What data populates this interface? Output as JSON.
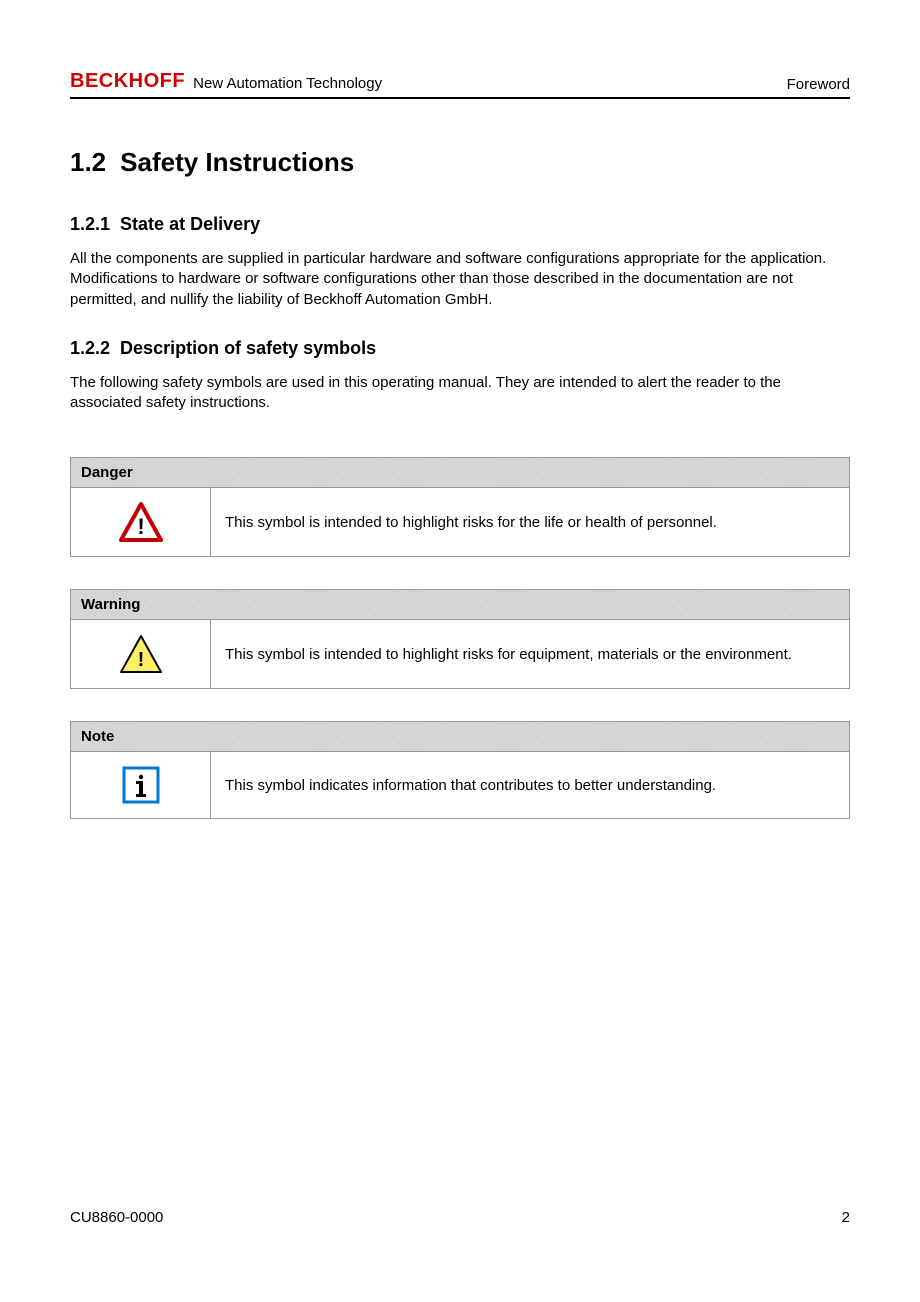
{
  "header": {
    "brand": "BECKHOFF",
    "tagline": "New Automation Technology",
    "section": "Foreword"
  },
  "heading": {
    "number": "1.2",
    "title": "Safety Instructions"
  },
  "sections": [
    {
      "number": "1.2.1",
      "title": "State at Delivery",
      "body": "All the components are supplied in particular hardware and software configurations appropriate for the application. Modifications to hardware or software configurations other than those described in the documentation are not permitted, and nullify the liability of Beckhoff Automation GmbH."
    },
    {
      "number": "1.2.2",
      "title": "Description of safety symbols",
      "body": "The following safety symbols are used in this operating manual. They are intended to alert the reader to the associated safety instructions."
    }
  ],
  "safety_boxes": [
    {
      "label": "Danger",
      "icon": "danger",
      "description": "This symbol is intended to highlight risks for the life or health of personnel."
    },
    {
      "label": "Warning",
      "icon": "warning",
      "description": "This symbol is intended to highlight risks for equipment, materials or the environment."
    },
    {
      "label": "Note",
      "icon": "note",
      "description": "This symbol indicates information that contributes to better understanding."
    }
  ],
  "footer": {
    "doc_id": "CU8860-0000",
    "page_number": "2"
  }
}
